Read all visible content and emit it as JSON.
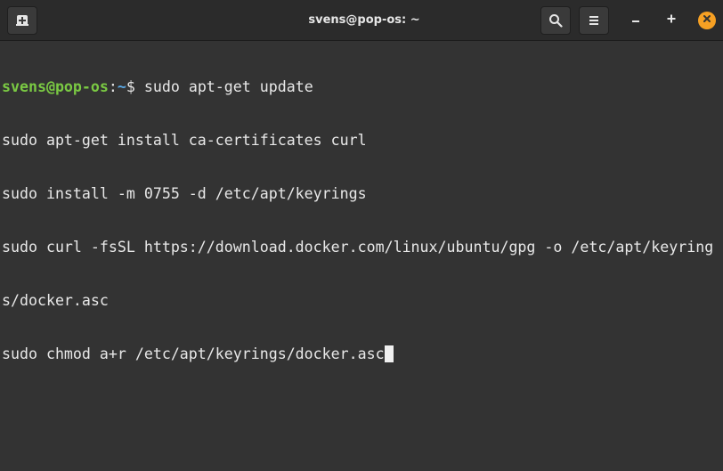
{
  "window": {
    "title": "svens@pop-os: ~"
  },
  "icons": {
    "new_tab": "new-tab-icon",
    "search": "search-icon",
    "menu": "hamburger-menu-icon",
    "minimize": "minimize-icon",
    "maximize": "maximize-icon",
    "close": "close-icon"
  },
  "colors": {
    "background": "#333333",
    "titlebar": "#2b2b2b",
    "prompt_user": "#7ac943",
    "prompt_path": "#5aa9e6",
    "text": "#e8e8e8",
    "close_button": "#f6a023"
  },
  "terminal": {
    "prompt": {
      "user_host": "svens@pop-os",
      "separator": ":",
      "path": "~",
      "symbol": "$ "
    },
    "first_command": "sudo apt-get update",
    "lines": [
      "sudo apt-get install ca-certificates curl",
      "sudo install -m 0755 -d /etc/apt/keyrings",
      "sudo curl -fsSL https://download.docker.com/linux/ubuntu/gpg -o /etc/apt/keyring",
      "s/docker.asc",
      "sudo chmod a+r /etc/apt/keyrings/docker.asc"
    ]
  }
}
